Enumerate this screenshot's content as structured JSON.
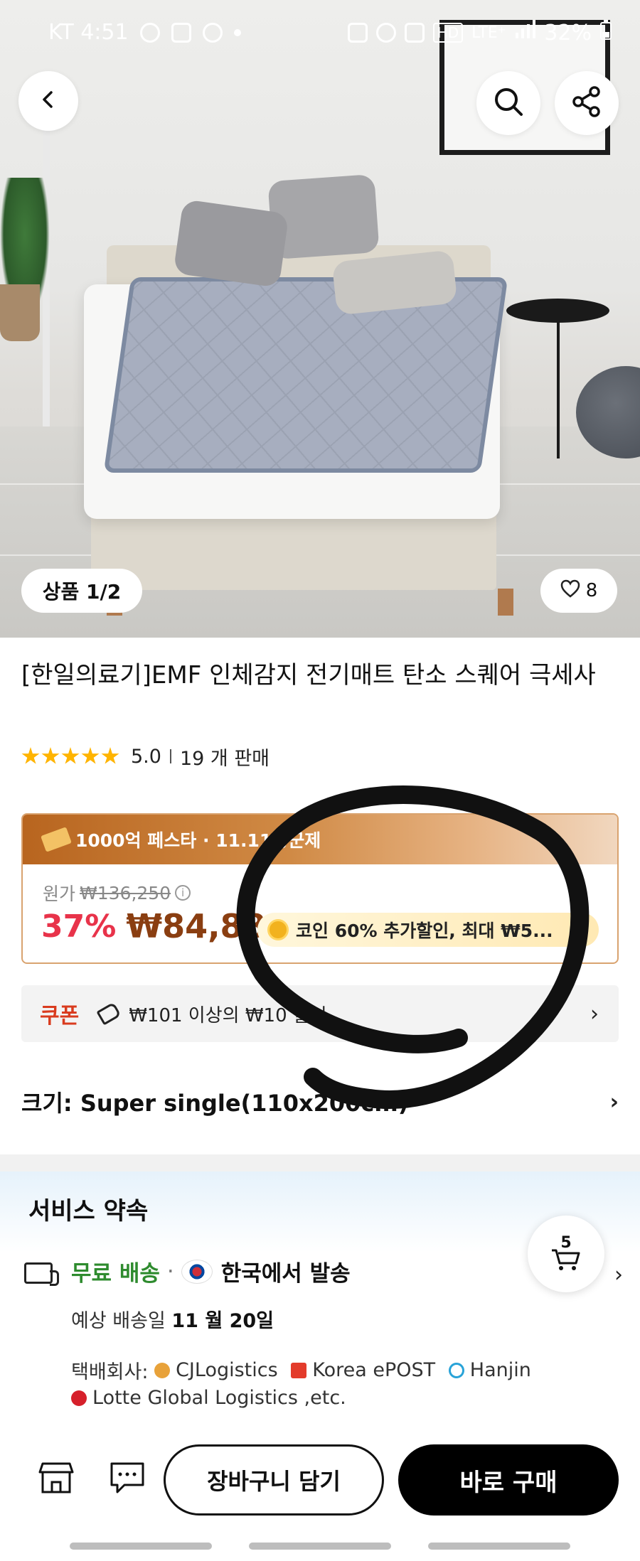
{
  "status_bar": {
    "carrier_time": "KT 4:51",
    "network": "LTE⁺",
    "battery": "32%"
  },
  "hero": {
    "image_counter": "상품 1/2",
    "like_count": "8"
  },
  "product": {
    "title": "[한일의료기]EMF 인체감지 전기매트 탄소 스퀘어 극세사",
    "rating": "5.0",
    "sold": "19 개 판매"
  },
  "promo": {
    "banner": "1000억 페스타 · 11.11광군제"
  },
  "price": {
    "original_label": "원가",
    "original_price": "₩136,250",
    "discount": "37%",
    "sale_price": "₩84,884",
    "coin_text": "코인 60% 추가할인, 최대 ₩5..."
  },
  "coupon": {
    "label": "쿠폰",
    "text": "₩101 이상의 ₩10 할인"
  },
  "option": {
    "text": "크기: Super single(110x200cm)"
  },
  "service": {
    "title": "서비스 약속",
    "free_shipping": "무료 배송",
    "ship_from": "한국에서 발송",
    "eta_label": "예상 배송일",
    "eta_date": "11 월 20일",
    "couriers_label": "택배회사:",
    "couriers": [
      "CJLogistics",
      "Korea ePOST",
      "Hanjin",
      "Lotte Global Logistics ,etc."
    ]
  },
  "cart_fab": {
    "count": "5"
  },
  "bottom": {
    "add_to_cart": "장바구니 담기",
    "buy_now": "바로 구매"
  },
  "colors": {
    "accent_red": "#e8334a",
    "price_brown": "#8a3e11",
    "free_green": "#2e8b2e",
    "coupon_red": "#d93b1e"
  },
  "icons": [
    "back-icon",
    "search-icon",
    "share-icon",
    "heart-icon",
    "info-icon",
    "tag-icon",
    "chevron-right-icon",
    "truck-icon",
    "korea-flag-icon",
    "cart-icon",
    "store-icon",
    "chat-icon"
  ]
}
